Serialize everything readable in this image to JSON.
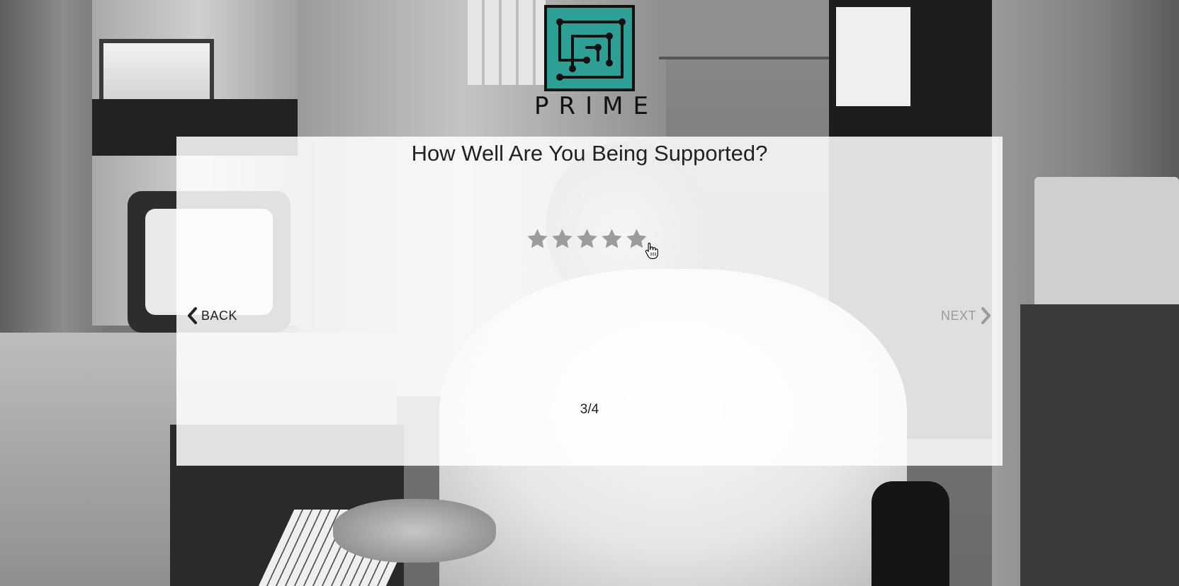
{
  "logo": {
    "wordmark": "PRIME",
    "icon": "circuit-maze-icon",
    "color": "#2e9f94"
  },
  "survey": {
    "question": "How Well Are You Being Supported?",
    "rating": {
      "max": 5,
      "value": 0,
      "star_color": "#9c9c9c",
      "icon": "star-icon"
    },
    "back_label": "BACK",
    "next_label": "NEXT",
    "back_icon": "chevron-left-icon",
    "next_icon": "chevron-right-icon",
    "next_enabled": false,
    "progress": "3/4"
  }
}
